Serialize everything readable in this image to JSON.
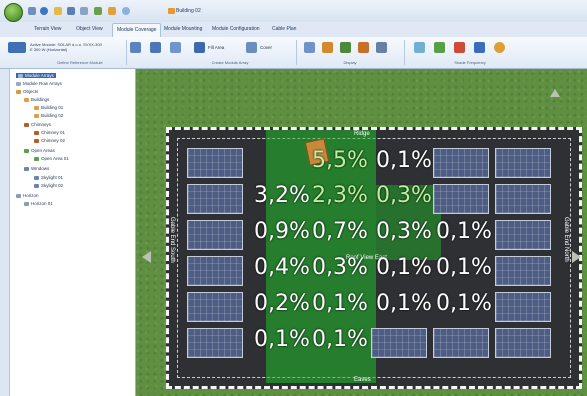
{
  "titlebar": {
    "document_title": "Building 02"
  },
  "tabs": [
    "Terrain View",
    "Object View",
    "Module Coverage",
    "Module Mounting",
    "Module Configuration",
    "Cable Plan"
  ],
  "active_tab": "Module Coverage",
  "ribbon": {
    "active_module_line1": "Active Module: SOLAR d.o.o. SVXX-300",
    "active_module_line2": "E 300 W (Horizontal)",
    "groups": [
      "Define Reference Module",
      "Create Module Array",
      "Display",
      "Shade Frequency"
    ],
    "fill_area_label": "Fill Area",
    "cover_label": "Cover"
  },
  "tree": {
    "root": "Module Arrays",
    "sub_root": "Module Row Arrays",
    "objects": "Objects",
    "buildings": "Buildings",
    "building1": "Building 01",
    "building2": "Building 02",
    "chimneys": "Chimneys",
    "chimney1": "Chimney 01",
    "chimney2": "Chimney 02",
    "open_areas": "Open Areas",
    "open_area1": "Open Area 01",
    "windows": "Windows",
    "skylight1": "Skylight 01",
    "skylight2": "Skylight 02",
    "horizon": "Horizon",
    "horizon1": "Horizon 01"
  },
  "view": {
    "ridge_label": "Ridge",
    "eaves_label": "Eaves",
    "roof_view_label": "Roof View East",
    "left_side_label": "Gable End South",
    "right_side_label": "Gable End North",
    "shade_rows": [
      [
        "5,5%",
        "0,1%"
      ],
      [
        "3,2%",
        "2,3%",
        "0,3%"
      ],
      [
        "0,9%",
        "0,7%",
        "0,3%",
        "0,1%"
      ],
      [
        "0,4%",
        "0,3%",
        "0,1%",
        "0,1%"
      ],
      [
        "0,2%",
        "0,1%",
        "0,1%",
        "0,1%"
      ],
      [
        "0,1%",
        "0,1%"
      ]
    ]
  },
  "colors": {
    "accent": "#3a66b0",
    "grass": "#5f8f40",
    "roof": "#2f3033",
    "shade_green": "#1ebe28"
  }
}
